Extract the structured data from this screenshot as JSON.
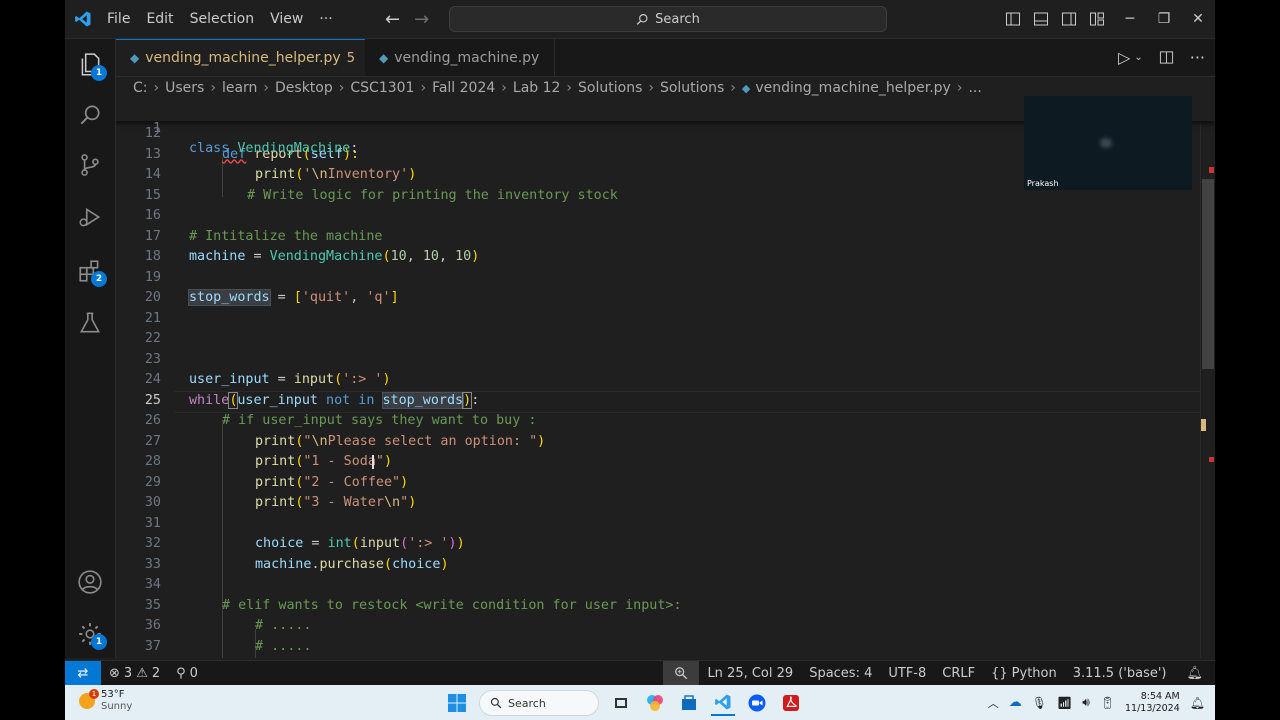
{
  "menu": {
    "file": "File",
    "edit": "Edit",
    "selection": "Selection",
    "view": "View",
    "more": "···"
  },
  "search": {
    "label": "Search"
  },
  "tabs": [
    {
      "label": "vending_machine_helper.py",
      "problems": "5",
      "active": true
    },
    {
      "label": "vending_machine.py",
      "active": false
    }
  ],
  "breadcrumb": [
    "C:",
    "Users",
    "learn",
    "Desktop",
    "CSC1301",
    "Fall 2024",
    "Lab 12",
    "Solutions",
    "Solutions",
    "vending_machine_helper.py",
    "..."
  ],
  "activity": {
    "explorer_badge": "1",
    "extensions_badge": "2",
    "settings_badge": "1"
  },
  "sticky": {
    "ln": "1",
    "kw": "class",
    "name": "VendingMachine",
    "colon": ":"
  },
  "lines": [
    {
      "ln": "12"
    },
    {
      "ln": "13",
      "t1": "def",
      "t2": "report",
      "t3": "(",
      "t4": "self",
      "t5": "):"
    },
    {
      "ln": "14",
      "t1": "print",
      "t2": "(",
      "t3": "'",
      "t4": "\\n",
      "t5": "Inventory'",
      "t6": ")"
    },
    {
      "ln": "15",
      "t1": "# Write logic for printing the inventory stock"
    },
    {
      "ln": "16"
    },
    {
      "ln": "17",
      "t1": "# Intitalize the machine"
    },
    {
      "ln": "18",
      "t1": "machine",
      "t2": " = ",
      "t3": "VendingMachine",
      "t4": "(",
      "t5": "10",
      "t6": ", ",
      "t7": "10",
      "t8": ", ",
      "t9": "10",
      "t10": ")"
    },
    {
      "ln": "19"
    },
    {
      "ln": "20",
      "t1": "stop_words",
      "t2": " = ",
      "t3": "[",
      "t4": "'quit'",
      "t5": ", ",
      "t6": "'q'",
      "t7": "]"
    },
    {
      "ln": "21"
    },
    {
      "ln": "22"
    },
    {
      "ln": "23"
    },
    {
      "ln": "24",
      "t1": "user_input",
      "t2": " = ",
      "t3": "input",
      "t4": "(",
      "t5": "':> '",
      "t6": ")"
    },
    {
      "ln": "25",
      "t1": "while",
      "t2": "(",
      "t3": "user_input",
      "t4": " not in ",
      "t5": "stop_words",
      "t6": ")",
      "t7": ":"
    },
    {
      "ln": "26",
      "t1": "# if user_input says they want to buy :"
    },
    {
      "ln": "27",
      "t1": "print",
      "t2": "(",
      "t3": "\"",
      "t4": "\\n",
      "t5": "Please select an option: \"",
      "t6": ")"
    },
    {
      "ln": "28",
      "t1": "print",
      "t2": "(",
      "t3": "\"1 - Soda\"",
      "t4": ")"
    },
    {
      "ln": "29",
      "t1": "print",
      "t2": "(",
      "t3": "\"2 - Coffee\"",
      "t4": ")"
    },
    {
      "ln": "30",
      "t1": "print",
      "t2": "(",
      "t3": "\"3 - Water",
      "t4": "\\n",
      "t5": "\"",
      "t6": ")"
    },
    {
      "ln": "31"
    },
    {
      "ln": "32",
      "t1": "choice",
      "t2": " = ",
      "t3": "int",
      "t4": "(",
      "t5": "input",
      "t6": "(",
      "t7": "':> '",
      "t8": ")",
      "t9": ")"
    },
    {
      "ln": "33",
      "t1": "machine",
      "t2": ".",
      "t3": "purchase",
      "t4": "(",
      "t5": "choice",
      "t6": ")"
    },
    {
      "ln": "34"
    },
    {
      "ln": "35",
      "t1": "# elif wants to restock <write condition for user input>:"
    },
    {
      "ln": "36",
      "t1": "# ....."
    },
    {
      "ln": "37",
      "t1": "# ....."
    }
  ],
  "video": {
    "name": "Prakash"
  },
  "status": {
    "errors": "3",
    "warnings": "2",
    "ports": "0",
    "position": "Ln 25, Col 29",
    "spaces": "Spaces: 4",
    "encoding": "UTF-8",
    "eol": "CRLF",
    "language": "Python",
    "interpreter": "3.11.5 ('base')"
  },
  "taskbar": {
    "temp": "53°F",
    "condition": "Sunny",
    "weather_badge": "1",
    "search": "Search",
    "time": "8:54 AM",
    "date": "11/13/2024"
  },
  "colors": {
    "accent": "#0078d4",
    "editor_bg": "#1f1f1f",
    "keyword": "#569cd6",
    "string": "#ce9178",
    "comment": "#6a9955",
    "function": "#dcdcaa"
  }
}
